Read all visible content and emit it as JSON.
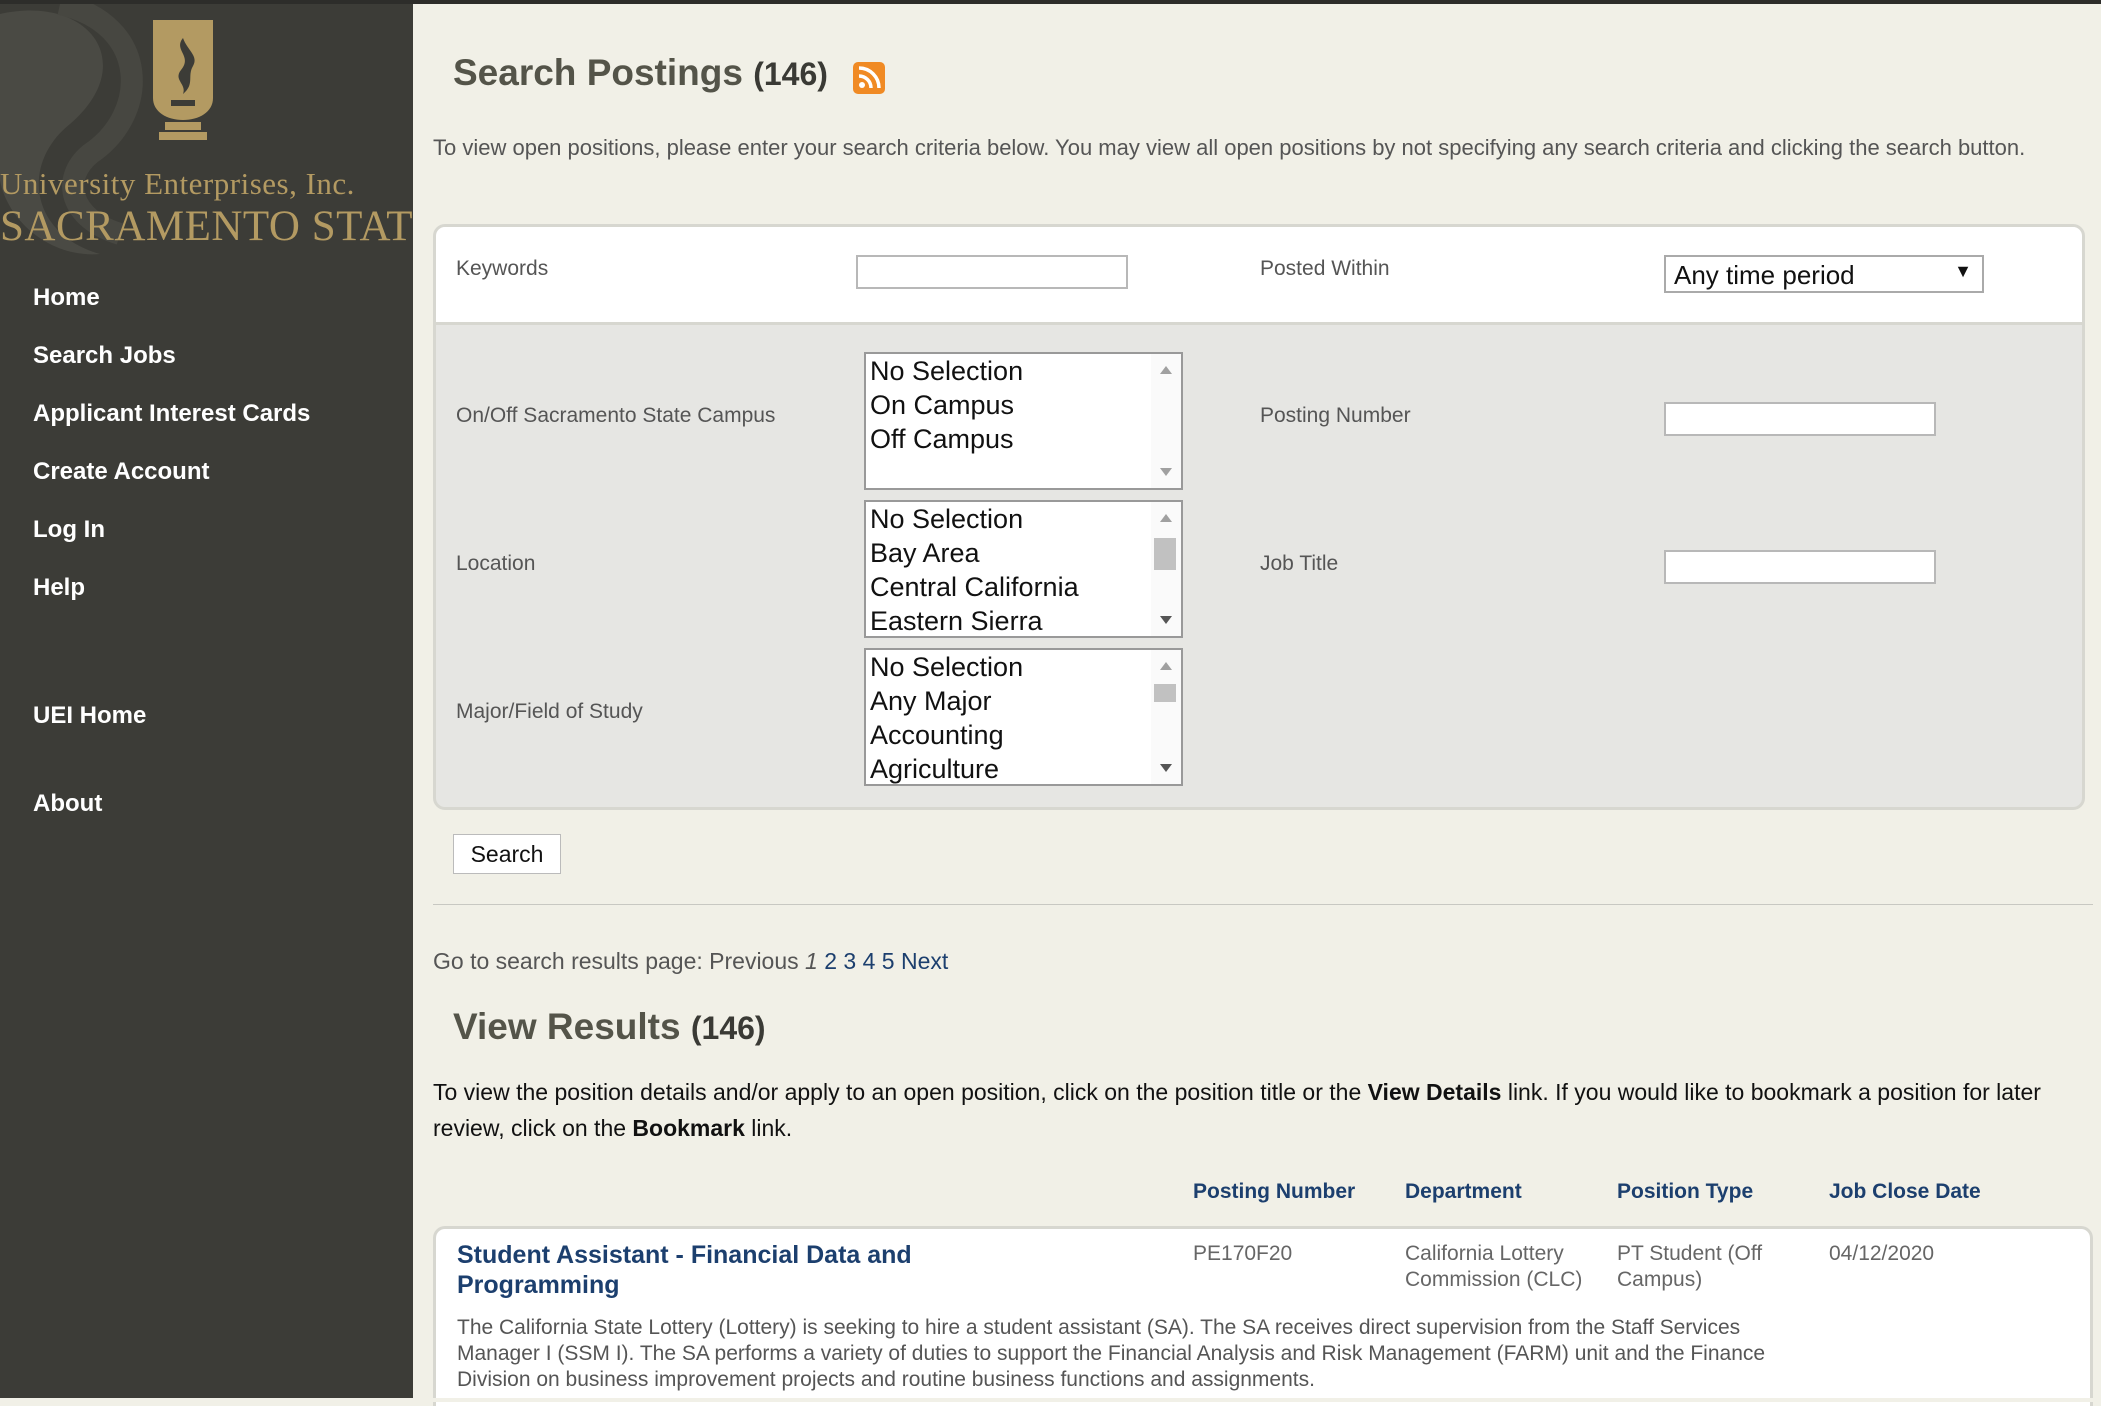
{
  "brand": {
    "line1": "University Enterprises, Inc.",
    "line2": "SACRAMENTO STATE",
    "gold": "#b39a62"
  },
  "nav": {
    "items": [
      "Home",
      "Search Jobs",
      "Applicant Interest Cards",
      "Create Account",
      "Log In",
      "Help"
    ],
    "secondary": [
      "UEI Home",
      "About"
    ]
  },
  "search": {
    "title": "Search Postings",
    "count": "(146)",
    "intro": "To view open positions, please enter your search criteria below. You may view all open positions by not specifying any search criteria and clicking the search button.",
    "keywords_label": "Keywords",
    "keywords_value": "",
    "posted_within_label": "Posted Within",
    "posted_within_value": "Any time period",
    "campus_label": "On/Off Sacramento State Campus",
    "campus_options": [
      "No Selection",
      "On Campus",
      "Off Campus"
    ],
    "posting_number_label": "Posting Number",
    "posting_number_value": "",
    "location_label": "Location",
    "location_options": [
      "No Selection",
      "Bay Area",
      "Central California",
      "Eastern Sierra"
    ],
    "job_title_label": "Job Title",
    "job_title_value": "",
    "major_label": "Major/Field of Study",
    "major_options": [
      "No Selection",
      "Any Major",
      "Accounting",
      "Agriculture"
    ],
    "search_button": "Search"
  },
  "pager": {
    "label": "Go to search results page:",
    "previous": "Previous",
    "current": "1",
    "pages": [
      "2",
      "3",
      "4",
      "5"
    ],
    "next": "Next"
  },
  "results": {
    "title": "View Results",
    "count": "(146)",
    "intro_1": "To view the position details and/or apply to an open position, click on the position title or the ",
    "view_details": "View Details",
    "intro_2": " link.  If you would like to bookmark a position for later review, click on the ",
    "bookmark": "Bookmark",
    "intro_3": " link.",
    "columns": [
      "Posting Number",
      "Department",
      "Position Type",
      "Job Close Date"
    ],
    "rows": [
      {
        "title": "Student Assistant - Financial Data and Programming",
        "posting_number": "PE170F20",
        "department": "California Lottery Commission (CLC)",
        "position_type": "PT Student (Off Campus)",
        "close_date": "04/12/2020",
        "description": "The California State Lottery (Lottery) is seeking to hire a student assistant (SA). The SA receives direct supervision from the Staff Services Manager I (SSM I). The SA performs a variety of duties to support the Financial Analysis and Risk Management (FARM) unit and the Finance Division on business improvement projects and routine business functions and assignments."
      }
    ]
  },
  "colors": {
    "sidebar": "#3c3c37",
    "page": "#f1f0e7",
    "link": "#1c3f6e",
    "rss": "#f08a24"
  }
}
